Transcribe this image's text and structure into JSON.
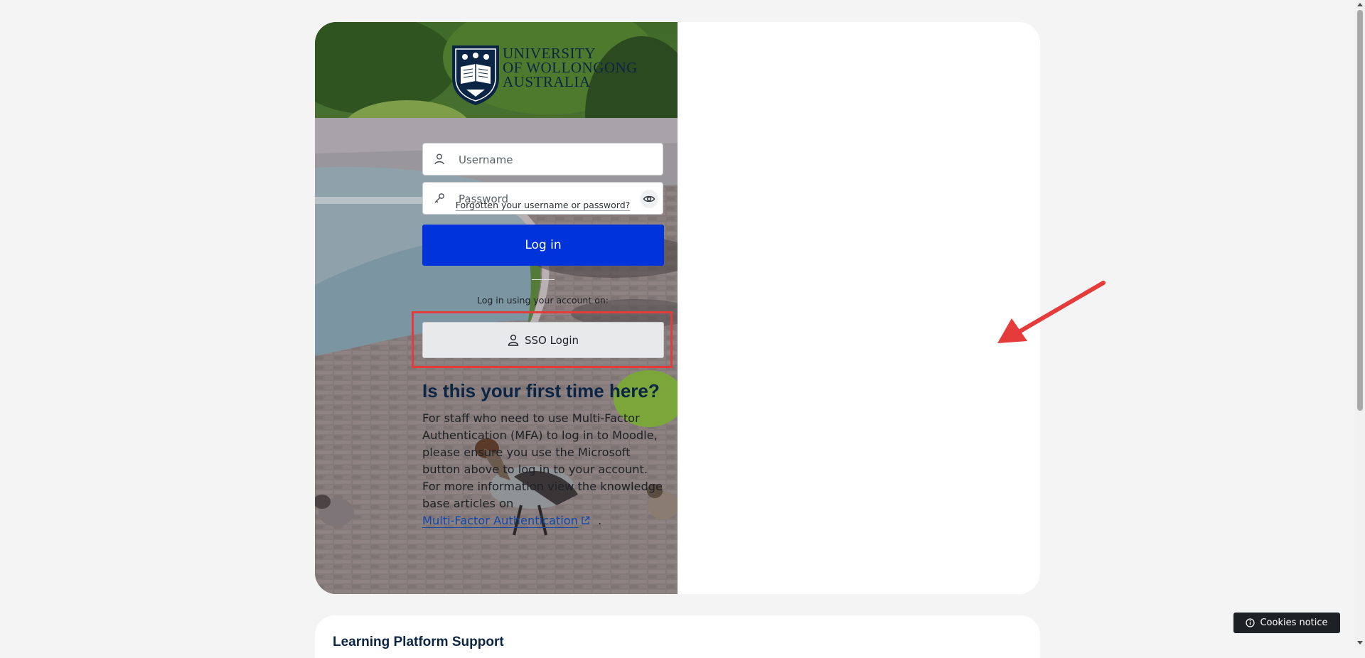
{
  "logo": {
    "line1": "UNIVERSITY",
    "line2": "OF WOLLONGONG",
    "line3": "AUSTRALIA"
  },
  "login": {
    "username_placeholder": "Username",
    "password_placeholder": "Password",
    "forgot_link": "Forgotten your username or password?",
    "login_button": "Log in",
    "alt_login_label": "Log in using your account on:",
    "sso_button": "SSO Login"
  },
  "first_time": {
    "title": "Is this your first time here?",
    "body": "For staff who need to use Multi-Factor Authentication (MFA) to log in to Moodle, please ensure you use the Microsoft button above to log in to your account. For more information view the knowledge base articles on",
    "link": "Multi-Factor Authentication",
    "period": "."
  },
  "support": {
    "title": "Learning Platform Support"
  },
  "cookies_notice": "Cookies notice",
  "colors": {
    "primary_button": "#0033d9",
    "highlight_red": "#e53b3b",
    "navy": "#0b2545",
    "link_blue": "#0f47ad"
  }
}
